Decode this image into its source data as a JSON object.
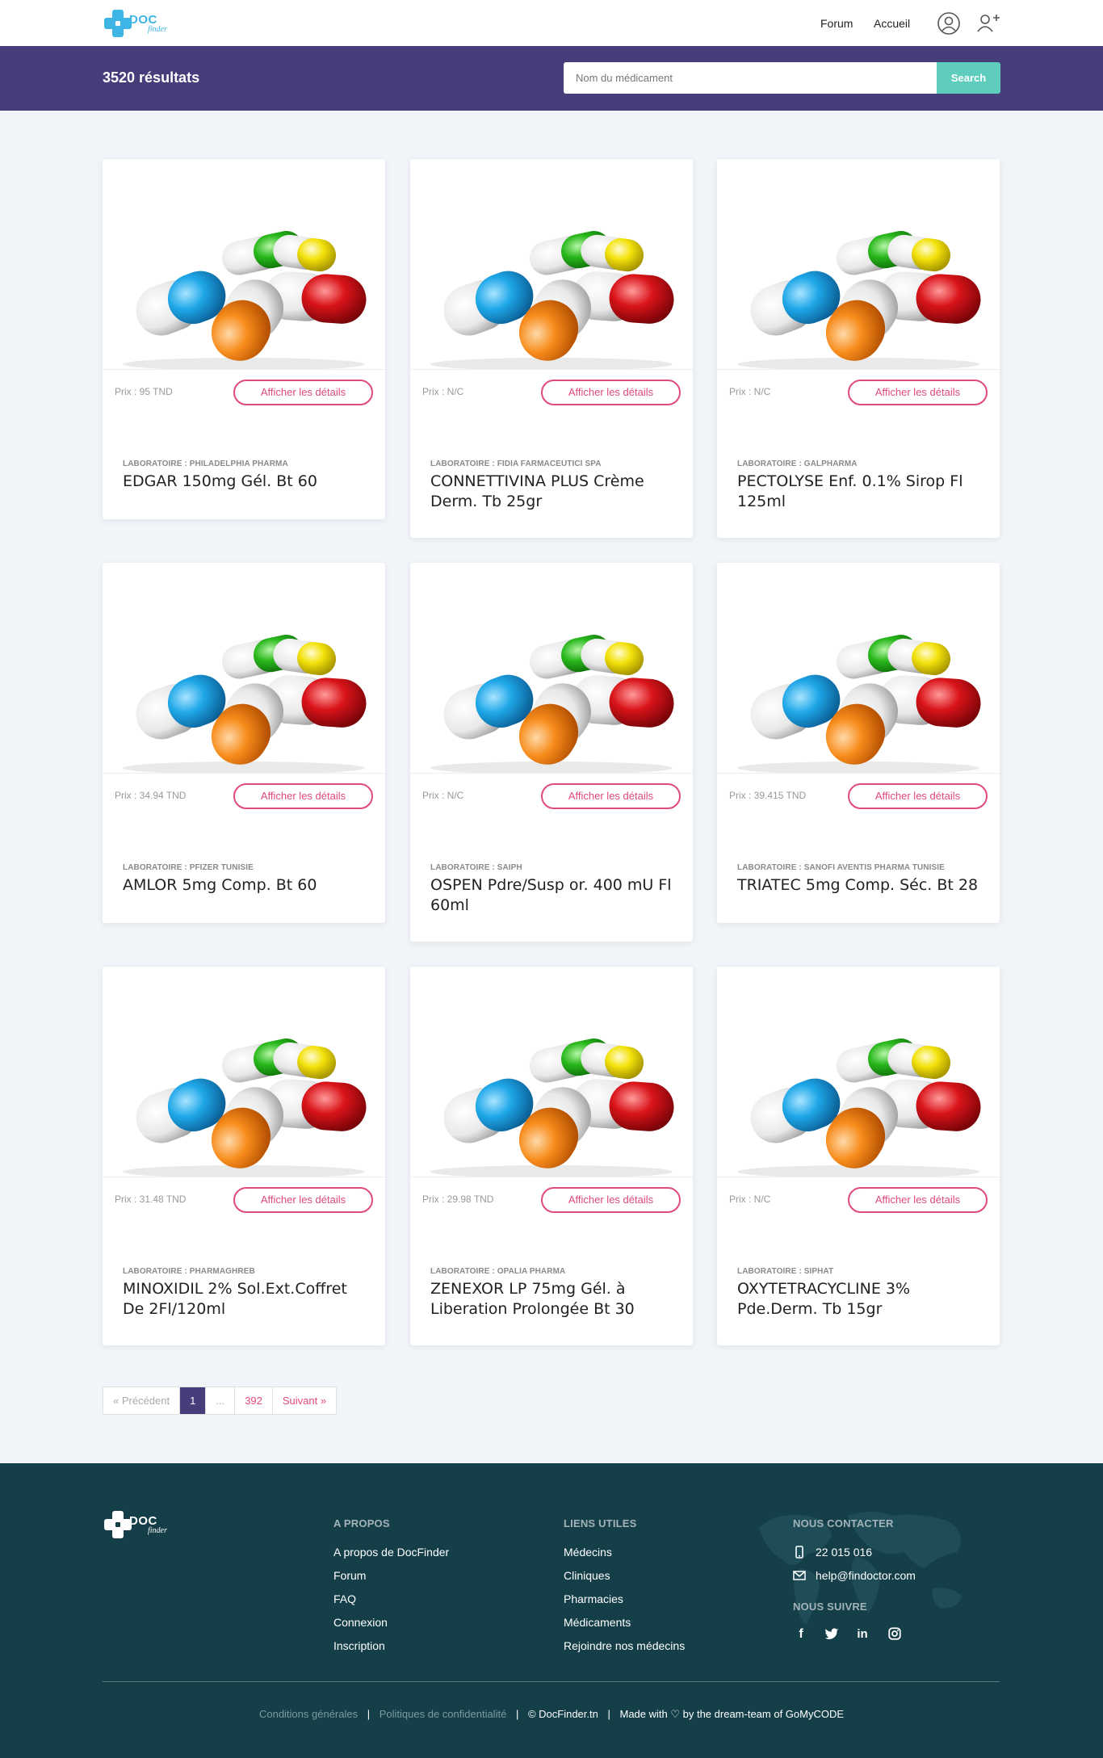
{
  "header": {
    "logo_word": "DOC",
    "logo_sub": "finder",
    "nav": {
      "forum": "Forum",
      "accueil": "Accueil"
    },
    "icons": {
      "user": "user-icon",
      "add_user": "add-user-icon"
    }
  },
  "search": {
    "result_count": "3520 résultats",
    "placeholder": "Nom du médicament",
    "button": "Search"
  },
  "products": [
    {
      "price": "Prix : 95 TND",
      "details": "Afficher les détails",
      "lab": "LABORATOIRE : PHILADELPHIA PHARMA",
      "name": "EDGAR 150mg Gél. Bt 60"
    },
    {
      "price": "Prix : N/C",
      "details": "Afficher les détails",
      "lab": "LABORATOIRE : FIDIA FARMACEUTICI SPA",
      "name": "CONNETTIVINA PLUS Crème Derm. Tb 25gr"
    },
    {
      "price": "Prix : N/C",
      "details": "Afficher les détails",
      "lab": "LABORATOIRE : GALPHARMA",
      "name": "PECTOLYSE Enf. 0.1% Sirop Fl 125ml"
    },
    {
      "price": "Prix : 34.94 TND",
      "details": "Afficher les détails",
      "lab": "LABORATOIRE : PFIZER TUNISIE",
      "name": "AMLOR 5mg Comp. Bt 60"
    },
    {
      "price": "Prix : N/C",
      "details": "Afficher les détails",
      "lab": "LABORATOIRE : SAIPH",
      "name": "OSPEN Pdre/Susp or. 400 mU Fl 60ml"
    },
    {
      "price": "Prix : 39.415 TND",
      "details": "Afficher les détails",
      "lab": "LABORATOIRE : SANOFI AVENTIS PHARMA TUNISIE",
      "name": "TRIATEC 5mg Comp. Séc. Bt 28"
    },
    {
      "price": "Prix : 31.48 TND",
      "details": "Afficher les détails",
      "lab": "LABORATOIRE : PHARMAGHREB",
      "name": "MINOXIDIL 2% Sol.Ext.Coffret De 2Fl/120ml"
    },
    {
      "price": "Prix : 29.98 TND",
      "details": "Afficher les détails",
      "lab": "LABORATOIRE : OPALIA PHARMA",
      "name": "ZENEXOR LP 75mg Gél. à Liberation Prolongée Bt 30"
    },
    {
      "price": "Prix : N/C",
      "details": "Afficher les détails",
      "lab": "LABORATOIRE : SIPHAT",
      "name": "OXYTETRACYCLINE 3% Pde.Derm. Tb 15gr"
    }
  ],
  "pagination": {
    "prev": "« Précédent",
    "current": "1",
    "ellipsis": "...",
    "last": "392",
    "next": "Suivant »"
  },
  "footer": {
    "logo_word": "DOC",
    "logo_sub": "finder",
    "apropos": {
      "heading": "A PROPOS",
      "links": [
        "A propos de DocFinder",
        "Forum",
        "FAQ",
        "Connexion",
        "Inscription"
      ]
    },
    "liens": {
      "heading": "LIENS UTILES",
      "links": [
        "Médecins",
        "Cliniques",
        "Pharmacies",
        "Médicaments",
        "Rejoindre nos médecins"
      ]
    },
    "contact": {
      "heading": "NOUS CONTACTER",
      "phone": "22 015 016",
      "email": "help@findoctor.com",
      "follow_heading": "NOUS SUIVRE",
      "social_icons": [
        "facebook-icon",
        "twitter-icon",
        "linkedin-icon",
        "instagram-icon"
      ]
    },
    "bottom": {
      "conditions": "Conditions générales",
      "sep1": "|",
      "privacy": "Politiques de confidentialité",
      "sep2": "|",
      "copyright": "© DocFinder.tn",
      "sep3": "|",
      "made_with": "Made with ♡ by the dream-team of GoMyCODE"
    }
  },
  "colors": {
    "header_bg": "#ffffff",
    "results_bar": "#463d7b",
    "search_button": "#5ecdbe",
    "accent_pink": "#e0497d",
    "logo_blue": "#3fb5e6",
    "footer_bg": "#153f48",
    "page_bg": "#f1f4f8"
  }
}
